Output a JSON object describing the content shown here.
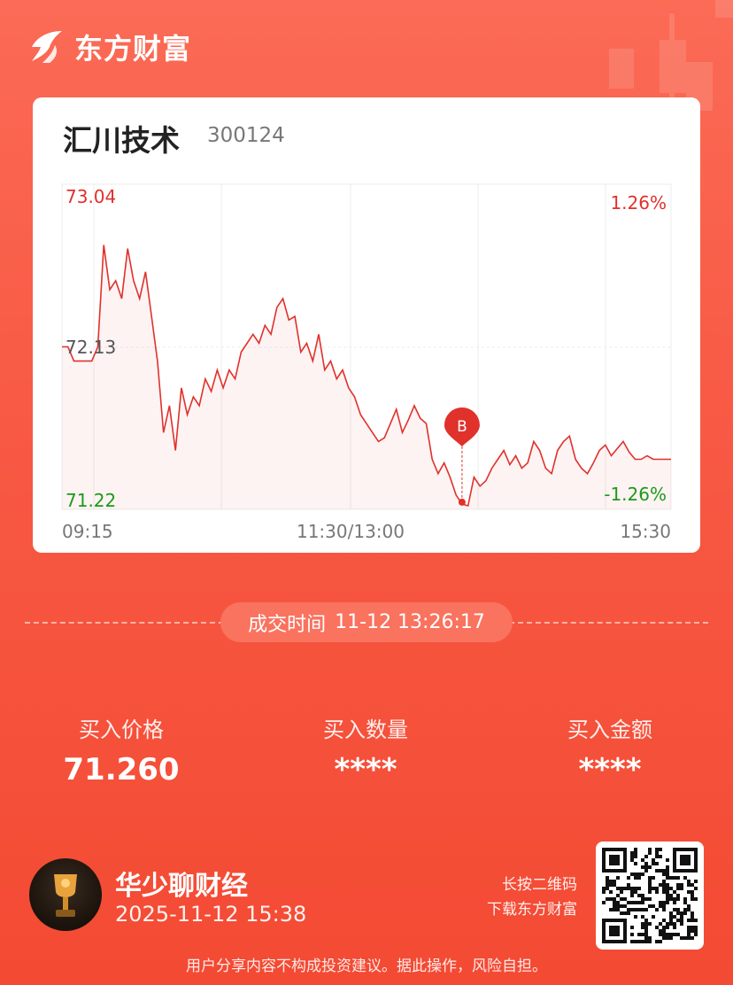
{
  "brand": {
    "name": "东方财富"
  },
  "stock": {
    "name": "汇川技术",
    "code": "300124"
  },
  "chart_data": {
    "type": "line",
    "price_axis": {
      "high": "73.04",
      "mid": "72.13",
      "low": "71.22"
    },
    "pct_axis": {
      "high": "1.26%",
      "low": "-1.26%"
    },
    "time_labels": [
      "09:15",
      "11:30/13:00",
      "15:30"
    ],
    "ylim": [
      71.22,
      73.04
    ],
    "prev_close": 72.13,
    "series": [
      {
        "values": [
          72.13,
          72.13,
          72.05,
          72.05,
          72.05,
          72.05,
          72.13,
          72.7,
          72.45,
          72.5,
          72.4,
          72.68,
          72.5,
          72.4,
          72.55,
          72.3,
          72.05,
          71.65,
          71.8,
          71.55,
          71.9,
          71.75,
          71.85,
          71.8,
          71.95,
          71.88,
          72.0,
          71.9,
          72.0,
          71.95,
          72.1,
          72.15,
          72.2,
          72.15,
          72.25,
          72.2,
          72.35,
          72.4,
          72.28,
          72.3,
          72.1,
          72.15,
          72.05,
          72.2,
          72.0,
          72.05,
          71.95,
          72.0,
          71.9,
          71.85,
          71.75,
          71.7,
          71.65,
          71.6,
          71.62,
          71.7,
          71.78,
          71.65,
          71.72,
          71.8,
          71.73,
          71.7,
          71.5,
          71.42,
          71.48,
          71.4,
          71.3,
          71.25,
          71.24,
          71.4,
          71.35,
          71.38,
          71.45,
          71.5,
          71.55,
          71.47,
          71.52,
          71.45,
          71.48,
          71.6,
          71.55,
          71.45,
          71.42,
          71.55,
          71.6,
          71.63,
          71.5,
          71.45,
          71.42,
          71.48,
          71.55,
          71.58,
          71.52,
          71.56,
          71.6,
          71.54,
          71.5,
          71.5,
          71.52,
          71.5,
          71.5,
          71.5,
          71.5
        ]
      }
    ],
    "trade_marker": {
      "label": "B",
      "price": 71.26,
      "index": 67
    }
  },
  "deal": {
    "label": "成交时间",
    "time": "11-12 13:26:17"
  },
  "stats": [
    {
      "label": "买入价格",
      "value": "71.260"
    },
    {
      "label": "买入数量",
      "value": "****"
    },
    {
      "label": "买入金额",
      "value": "****"
    }
  ],
  "author": {
    "name": "华少聊财经",
    "time": "2025-11-12 15:38"
  },
  "qr_hint": {
    "line1": "长按二维码",
    "line2": "下载东方财富"
  },
  "disclaimer": "用户分享内容不构成投资建议。据此操作，风险自担。",
  "colors": {
    "up": "#e0312b",
    "down": "#1b9a1b",
    "accent": "#f85a45"
  }
}
